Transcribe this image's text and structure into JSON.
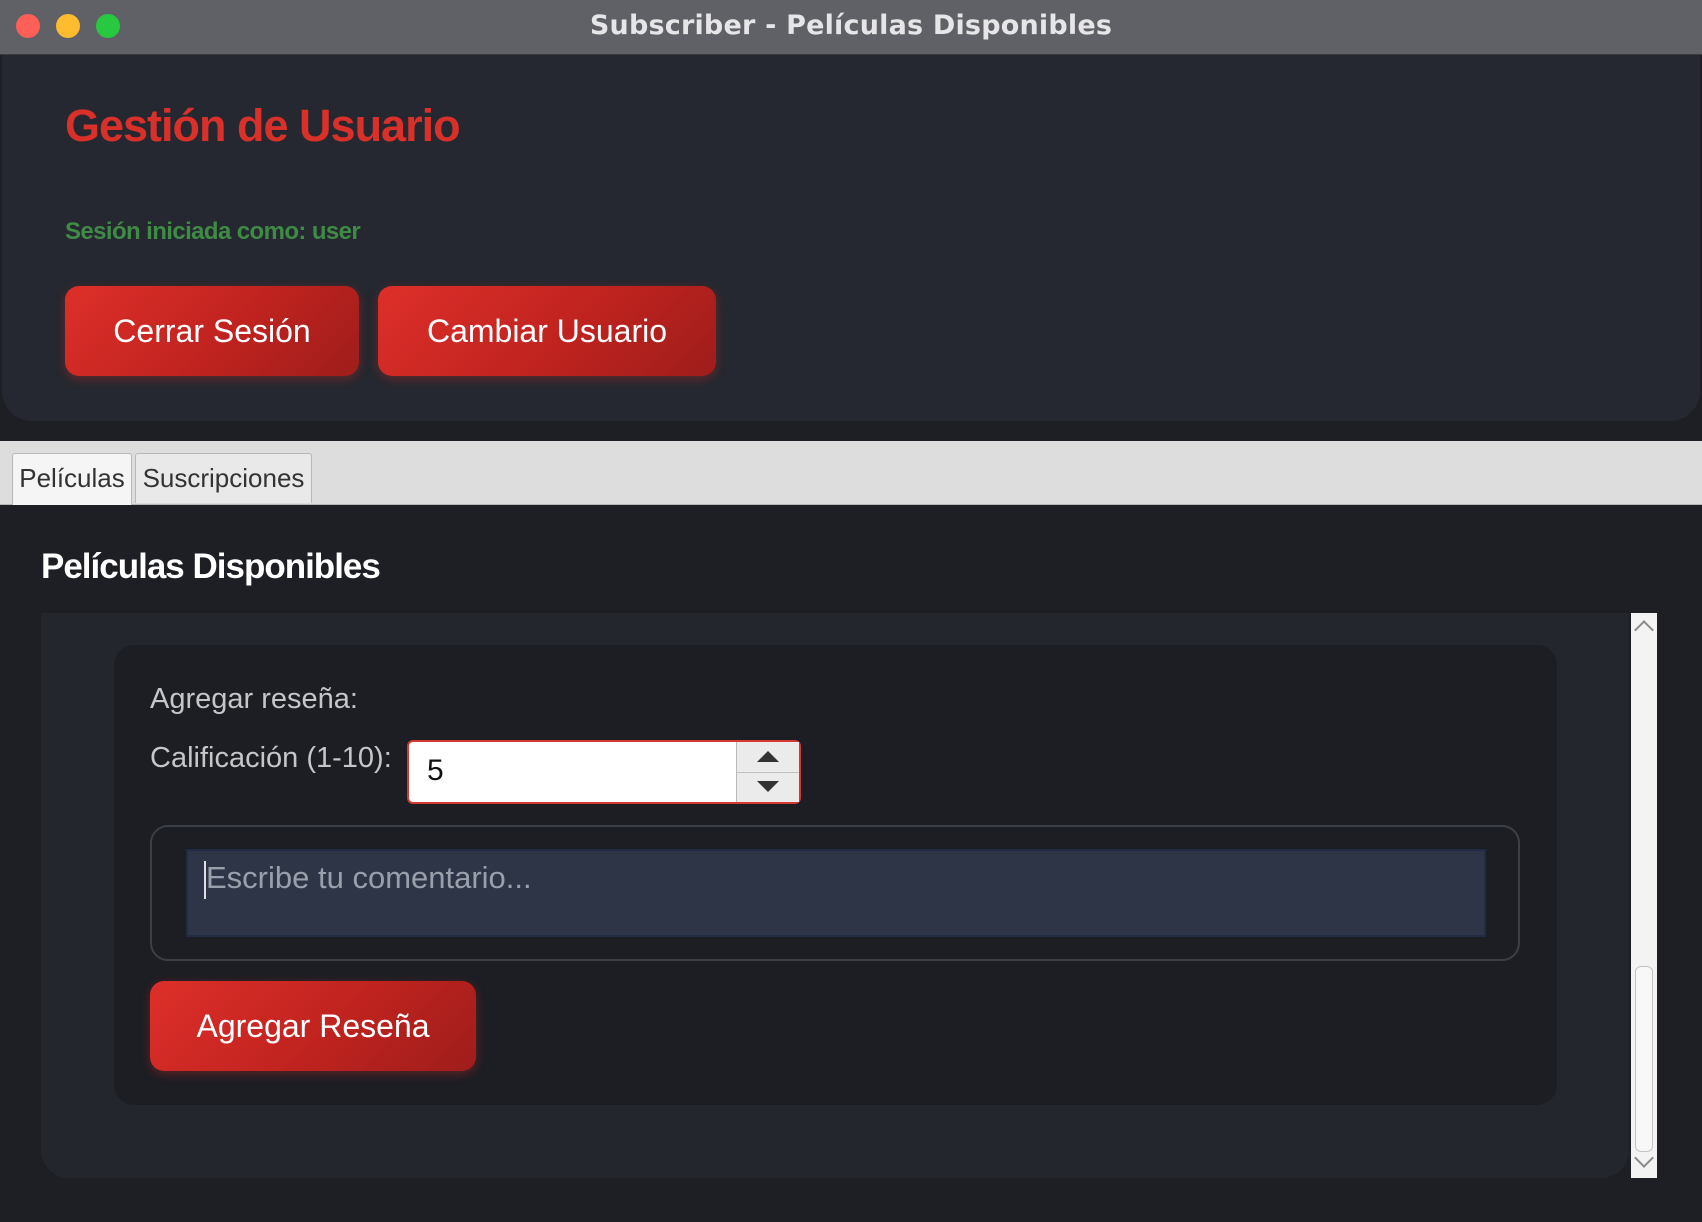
{
  "window": {
    "title": "Subscriber - Películas Disponibles"
  },
  "header": {
    "title": "Gestión de Usuario",
    "session_text": "Sesión iniciada como: user",
    "logout_label": "Cerrar Sesión",
    "change_user_label": "Cambiar Usuario"
  },
  "tabs": [
    {
      "label": "Películas",
      "selected": true
    },
    {
      "label": "Suscripciones",
      "selected": false
    }
  ],
  "main": {
    "section_title": "Películas Disponibles",
    "review": {
      "add_label": "Agregar reseña:",
      "rating_label": "Calificación (1-10):",
      "rating_value": "5",
      "comment_placeholder": "Escribe tu comentario...",
      "submit_label": "Agregar Reseña"
    }
  },
  "colors": {
    "accent_red": "#d9302a",
    "session_green": "#3f8a45",
    "background": "#1d1f25"
  },
  "icons": {
    "spinner_up": "triangle-up-icon",
    "spinner_down": "triangle-down-icon",
    "scroll_up": "chevron-up-icon",
    "scroll_down": "chevron-down-icon"
  }
}
